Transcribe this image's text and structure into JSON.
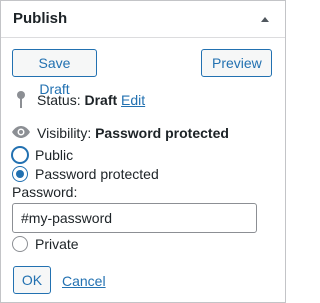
{
  "header": {
    "title": "Publish",
    "toggle_icon": "triangle-up-icon"
  },
  "actions": {
    "save_draft": "Save Draft",
    "preview": "Preview"
  },
  "status": {
    "label": "Status:",
    "value": "Draft",
    "edit": "Edit",
    "icon": "pin-icon"
  },
  "visibility": {
    "label": "Visibility:",
    "value": "Password protected",
    "icon": "eye-icon",
    "options": [
      {
        "label": "Public",
        "checked": false
      },
      {
        "label": "Password protected",
        "checked": true
      },
      {
        "label": "Private",
        "checked": false
      }
    ],
    "password_label": "Password:",
    "password_value": "#my-password"
  },
  "footer": {
    "ok": "OK",
    "cancel": "Cancel"
  },
  "colors": {
    "accent": "#2271b1",
    "border": "#c3c4c7",
    "text": "#1d2327"
  }
}
